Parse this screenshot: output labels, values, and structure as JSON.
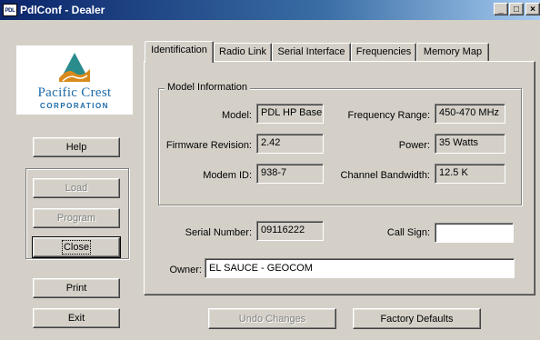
{
  "window": {
    "icon_text": "PDL",
    "title": "PdlConf - Dealer",
    "minimize_glyph": "_",
    "maximize_glyph": "□",
    "close_glyph": "×"
  },
  "logo": {
    "name": "Pacific Crest",
    "sub": "CORPORATION"
  },
  "side_buttons": {
    "help": "Help",
    "load": "Load",
    "program": "Program",
    "close": "Close",
    "print": "Print",
    "exit": "Exit"
  },
  "tabs": [
    {
      "label": "Identification",
      "active": true
    },
    {
      "label": "Radio Link",
      "active": false
    },
    {
      "label": "Serial Interface",
      "active": false
    },
    {
      "label": "Frequencies",
      "active": false
    },
    {
      "label": "Memory Map",
      "active": false
    }
  ],
  "model_info": {
    "legend": "Model Information",
    "model_label": "Model:",
    "model_value": "PDL HP Base",
    "freq_range_label": "Frequency Range:",
    "freq_range_value": "450-470 MHz",
    "firmware_label": "Firmware Revision:",
    "firmware_value": "2.42",
    "power_label": "Power:",
    "power_value": "35 Watts",
    "modem_id_label": "Modem ID:",
    "modem_id_value": "938-7",
    "bandwidth_label": "Channel Bandwidth:",
    "bandwidth_value": "12.5 K"
  },
  "identity": {
    "serial_label": "Serial Number:",
    "serial_value": "09116222",
    "callsign_label": "Call Sign:",
    "callsign_value": "",
    "owner_label": "Owner:",
    "owner_value": "EL SAUCE - GEOCOM"
  },
  "bottom_buttons": {
    "undo": "Undo Changes",
    "factory": "Factory Defaults"
  }
}
